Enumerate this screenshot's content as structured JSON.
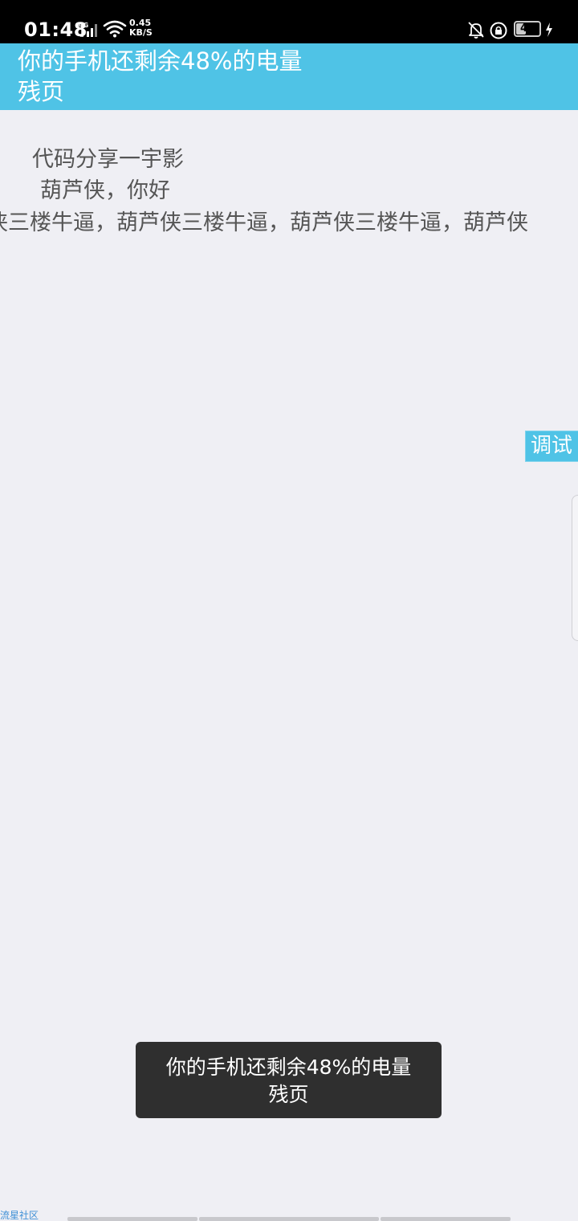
{
  "status_bar": {
    "time": "01:48",
    "network_type": "4G",
    "speed_value": "0.45",
    "speed_unit": "KB/S",
    "battery_level": "48",
    "battery_fraction": 0.48
  },
  "title_bar": {
    "line1": "你的手机还剩余48%的电量",
    "line2": "残页"
  },
  "content": {
    "code_share": "代码分享一宇影",
    "greeting": "葫芦侠，你好",
    "marquee": "侠三楼牛逼，葫芦侠三楼牛逼，葫芦侠三楼牛逼，葫芦侠"
  },
  "debug_button": {
    "label": "调试"
  },
  "toast": {
    "line1": "你的手机还剩余48%的电量",
    "line2": "残页"
  },
  "watermark": {
    "text": "流星社区"
  },
  "colors": {
    "title_bar_bg": "#4fc3e6",
    "page_bg": "#efeff4",
    "toast_bg": "#2f2f2f",
    "text_gray": "#555555"
  }
}
